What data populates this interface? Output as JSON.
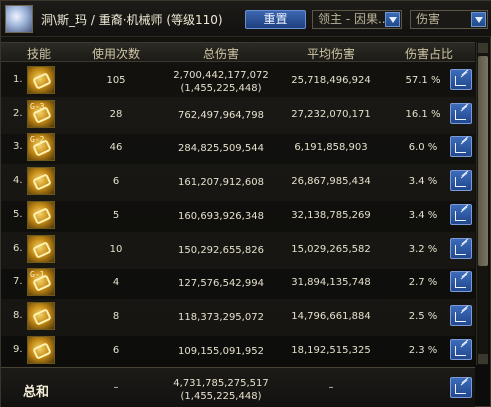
{
  "header": {
    "title": "洞\\斯_玛 / 重裔·机械师 (等级110)",
    "reset_label": "重置",
    "filter_select": "领主 - 因果...",
    "metric_select": "伤害"
  },
  "columns": [
    "技能",
    "使用次数",
    "总伤害",
    "平均伤害",
    "伤害占比"
  ],
  "rows": [
    {
      "index": "1.",
      "icon_glyph": "",
      "count": "105",
      "total": "2,700,442,177,072",
      "total_sub": "(1,455,225,448)",
      "avg": "25,718,496,924",
      "pct": "57.1 %"
    },
    {
      "index": "2.",
      "icon_glyph": "G-3",
      "count": "28",
      "total": "762,497,964,798",
      "total_sub": "",
      "avg": "27,232,070,171",
      "pct": "16.1 %"
    },
    {
      "index": "3.",
      "icon_glyph": "G-2",
      "count": "46",
      "total": "284,825,509,544",
      "total_sub": "",
      "avg": "6,191,858,903",
      "pct": "6.0 %"
    },
    {
      "index": "4.",
      "icon_glyph": "",
      "count": "6",
      "total": "161,207,912,608",
      "total_sub": "",
      "avg": "26,867,985,434",
      "pct": "3.4 %"
    },
    {
      "index": "5.",
      "icon_glyph": "",
      "count": "5",
      "total": "160,693,926,348",
      "total_sub": "",
      "avg": "32,138,785,269",
      "pct": "3.4 %"
    },
    {
      "index": "6.",
      "icon_glyph": "",
      "count": "10",
      "total": "150,292,655,826",
      "total_sub": "",
      "avg": "15,029,265,582",
      "pct": "3.2 %"
    },
    {
      "index": "7.",
      "icon_glyph": "G-1",
      "count": "4",
      "total": "127,576,542,994",
      "total_sub": "",
      "avg": "31,894,135,748",
      "pct": "2.7 %"
    },
    {
      "index": "8.",
      "icon_glyph": "",
      "count": "8",
      "total": "118,373,295,072",
      "total_sub": "",
      "avg": "14,796,661,884",
      "pct": "2.5 %"
    },
    {
      "index": "9.",
      "icon_glyph": "",
      "count": "6",
      "total": "109,155,091,952",
      "total_sub": "",
      "avg": "18,192,515,325",
      "pct": "2.3 %"
    }
  ],
  "total_row": {
    "label": "总和",
    "count": "–",
    "total": "4,731,785,275,517",
    "total_sub": "(1,455,225,448)",
    "avg": "–"
  },
  "colors": {
    "accent": "#2f5aa6",
    "text": "#e6e0cc",
    "panel": "#121110"
  }
}
